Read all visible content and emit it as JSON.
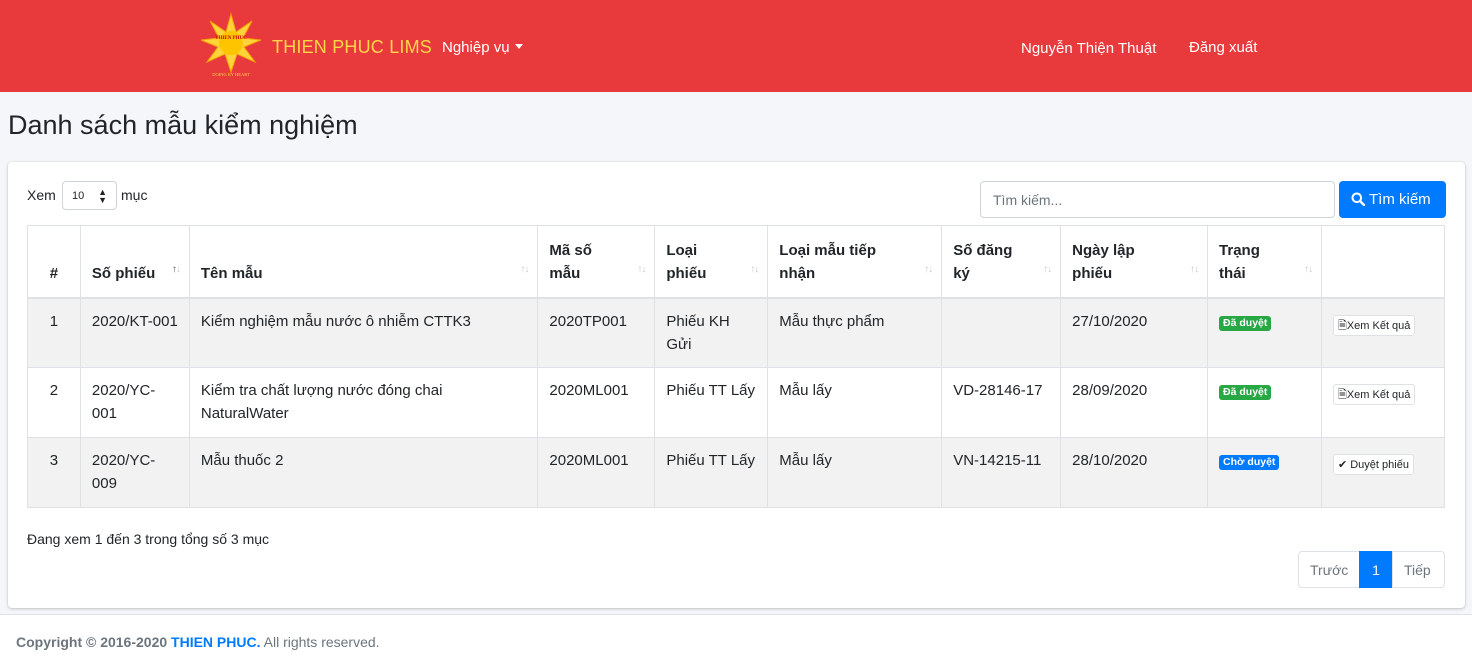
{
  "header": {
    "logo_text_top": "THIEN PHUC",
    "logo_text_bottom": "DOING BY HEART",
    "brand": "THIEN PHUC LIMS",
    "menu": "Nghiệp vụ",
    "user": "Nguyễn Thiện Thuật",
    "logout": "Đăng xuất"
  },
  "page": {
    "title": "Danh sách mẫu kiểm nghiệm"
  },
  "controls": {
    "length_label_before": "Xem",
    "length_value": "10",
    "length_label_after": "mục",
    "search_placeholder": "Tìm kiếm...",
    "search_button": "Tìm kiếm"
  },
  "table": {
    "headers": [
      "#",
      "Số phiếu",
      "Tên mẫu",
      "Mã số mẫu",
      "Loại phiếu",
      "Loại mẫu tiếp nhận",
      "Số đăng ký",
      "Ngày lập phiếu",
      "Trạng thái",
      ""
    ],
    "rows": [
      {
        "idx": "1",
        "so_phieu": "2020/KT-001",
        "ten_mau": "Kiểm nghiệm mẫu nước ô nhiễm CTTK3",
        "ma_so": "2020TP001",
        "loai_phieu": "Phiếu KH Gửi",
        "loai_mau": "Mẫu thực phẩm",
        "so_dk": "",
        "ngay": "27/10/2020",
        "status": "Đã duyệt",
        "status_color": "#28a745",
        "action": "Xem Kết quả",
        "action_icon": "file-icon"
      },
      {
        "idx": "2",
        "so_phieu": "2020/YC-001",
        "ten_mau": "Kiểm tra chất lượng nước đóng chai NaturalWater",
        "ma_so": "2020ML001",
        "loai_phieu": "Phiếu TT Lấy",
        "loai_mau": "Mẫu lấy",
        "so_dk": "VD-28146-17",
        "ngay": "28/09/2020",
        "status": "Đã duyệt",
        "status_color": "#28a745",
        "action": "Xem Kết quả",
        "action_icon": "file-icon"
      },
      {
        "idx": "3",
        "so_phieu": "2020/YC-009",
        "ten_mau": "Mẫu thuốc 2",
        "ma_so": "2020ML001",
        "loai_phieu": "Phiếu TT Lấy",
        "loai_mau": "Mẫu lấy",
        "so_dk": "VN-14215-11",
        "ngay": "28/10/2020",
        "status": "Chờ duyệt",
        "status_color": "#007bff",
        "action": "Duyệt phiếu",
        "action_icon": "check-icon"
      }
    ]
  },
  "info": "Đang xem 1 đến 3 trong tổng số 3 mục",
  "pagination": {
    "prev": "Trước",
    "current": "1",
    "next": "Tiếp"
  },
  "footer": {
    "prefix": "Copyright © 2016-2020 ",
    "brand": "THIEN PHUC.",
    "suffix": " All rights reserved."
  },
  "colors": {
    "navbar": "#e83a3c",
    "primary": "#007bff",
    "success": "#28a745",
    "brand_text": "#ffd54a"
  }
}
